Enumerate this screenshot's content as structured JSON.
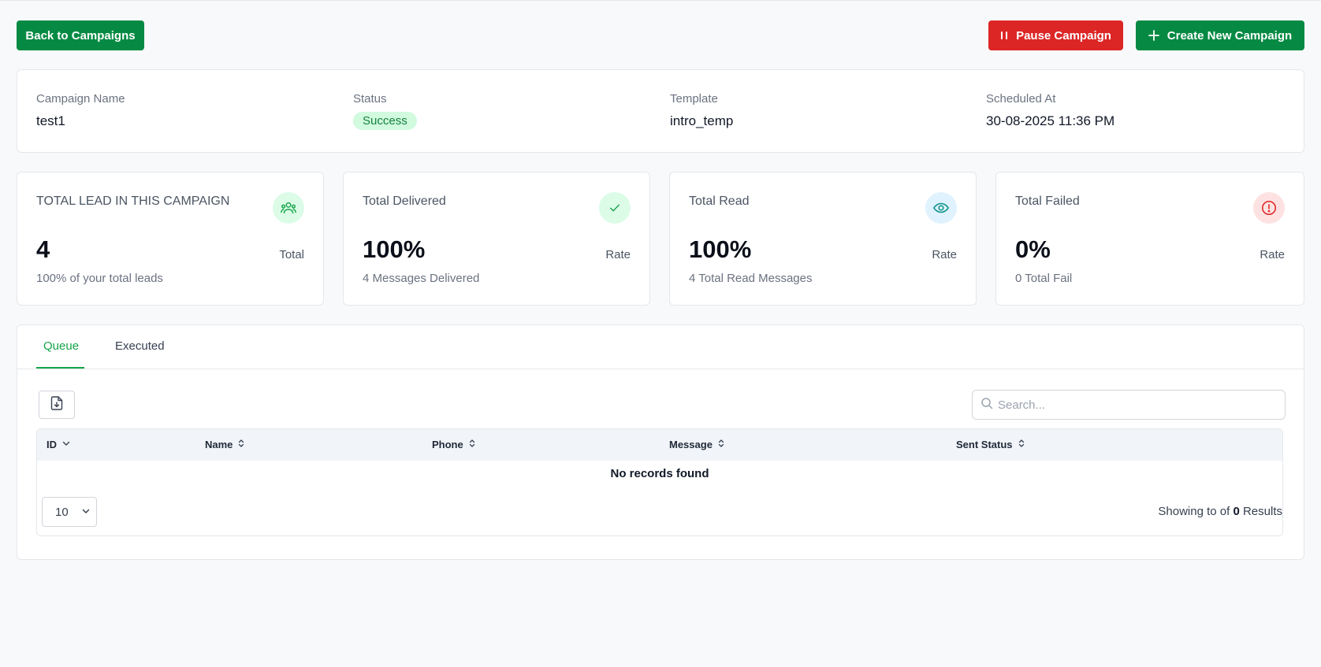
{
  "toolbar": {
    "back_label": "Back to Campaigns",
    "pause_label": "Pause Campaign",
    "create_label": "Create New Campaign"
  },
  "info": {
    "name_label": "Campaign Name",
    "name_value": "test1",
    "status_label": "Status",
    "status_value": "Success",
    "template_label": "Template",
    "template_value": "intro_temp",
    "scheduled_label": "Scheduled At",
    "scheduled_value": "30-08-2025 11:36 PM"
  },
  "stats": [
    {
      "title": "TOTAL LEAD IN THIS CAMPAIGN",
      "value": "4",
      "unit": "Total",
      "sub": "100% of your total leads",
      "icon": "users-icon"
    },
    {
      "title": "Total Delivered",
      "value": "100%",
      "unit": "Rate",
      "sub": "4 Messages Delivered",
      "icon": "check-icon"
    },
    {
      "title": "Total Read",
      "value": "100%",
      "unit": "Rate",
      "sub": "4 Total Read Messages",
      "icon": "eye-icon"
    },
    {
      "title": "Total Failed",
      "value": "0%",
      "unit": "Rate",
      "sub": "0 Total Fail",
      "icon": "alert-circle-icon"
    }
  ],
  "tabs": [
    {
      "label": "Queue",
      "active": true
    },
    {
      "label": "Executed",
      "active": false
    }
  ],
  "search": {
    "placeholder": "Search...",
    "value": ""
  },
  "table": {
    "columns": [
      "ID",
      "Name",
      "Phone",
      "Message",
      "Sent Status"
    ],
    "empty_text": "No records found",
    "page_size": "10",
    "results_prefix": "Showing to of",
    "results_count": "0",
    "results_suffix": "Results"
  },
  "colors": {
    "primary": "#068a43",
    "danger": "#dc2626",
    "success_badge_bg": "#d1fadf",
    "success_badge_text": "#15803d"
  }
}
